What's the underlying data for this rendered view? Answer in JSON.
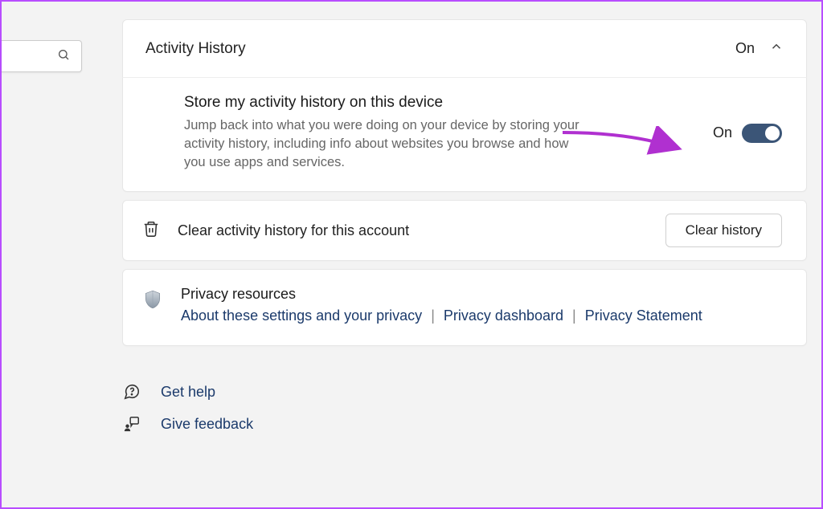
{
  "section": {
    "title": "Activity History",
    "status": "On"
  },
  "store": {
    "heading": "Store my activity history on this device",
    "description": "Jump back into what you were doing on your device by storing your activity history, including info about websites you browse and how you use apps and services.",
    "state": "On"
  },
  "clear": {
    "label": "Clear activity history for this account",
    "button": "Clear history"
  },
  "privacy": {
    "title": "Privacy resources",
    "links": {
      "about": "About these settings and your privacy",
      "dashboard": "Privacy dashboard",
      "statement": "Privacy Statement"
    }
  },
  "footer": {
    "help": "Get help",
    "feedback": "Give feedback"
  }
}
